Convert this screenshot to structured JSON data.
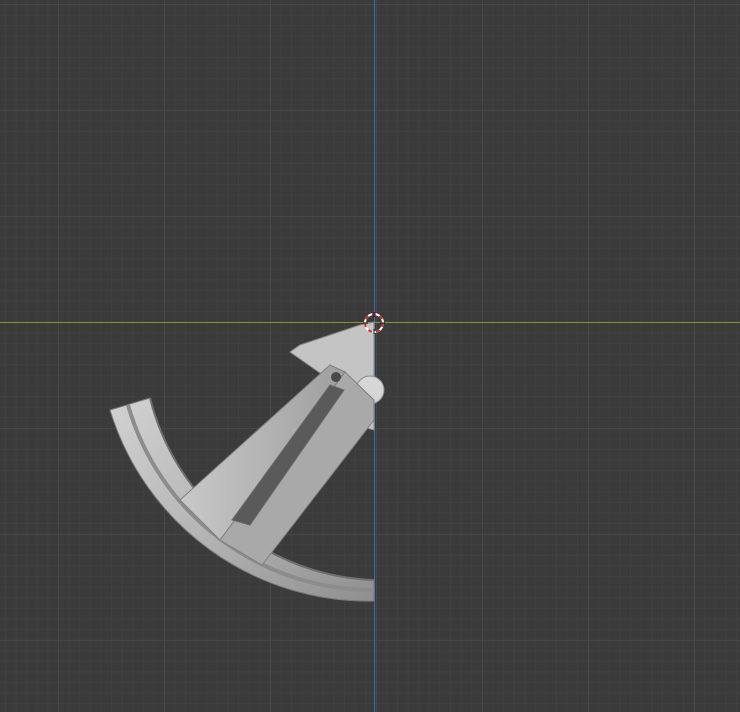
{
  "viewport": {
    "colors": {
      "background": "#3b3b3b",
      "grid_major": "#474747",
      "grid_minor": "#404040",
      "axis_x": "#7f9a2a",
      "axis_z": "#2f6fb3",
      "model": "#b9b9b9"
    },
    "objects": {
      "model_icon": "wheel-rim-mesh",
      "cursor_icon": "3d-cursor-icon"
    }
  }
}
